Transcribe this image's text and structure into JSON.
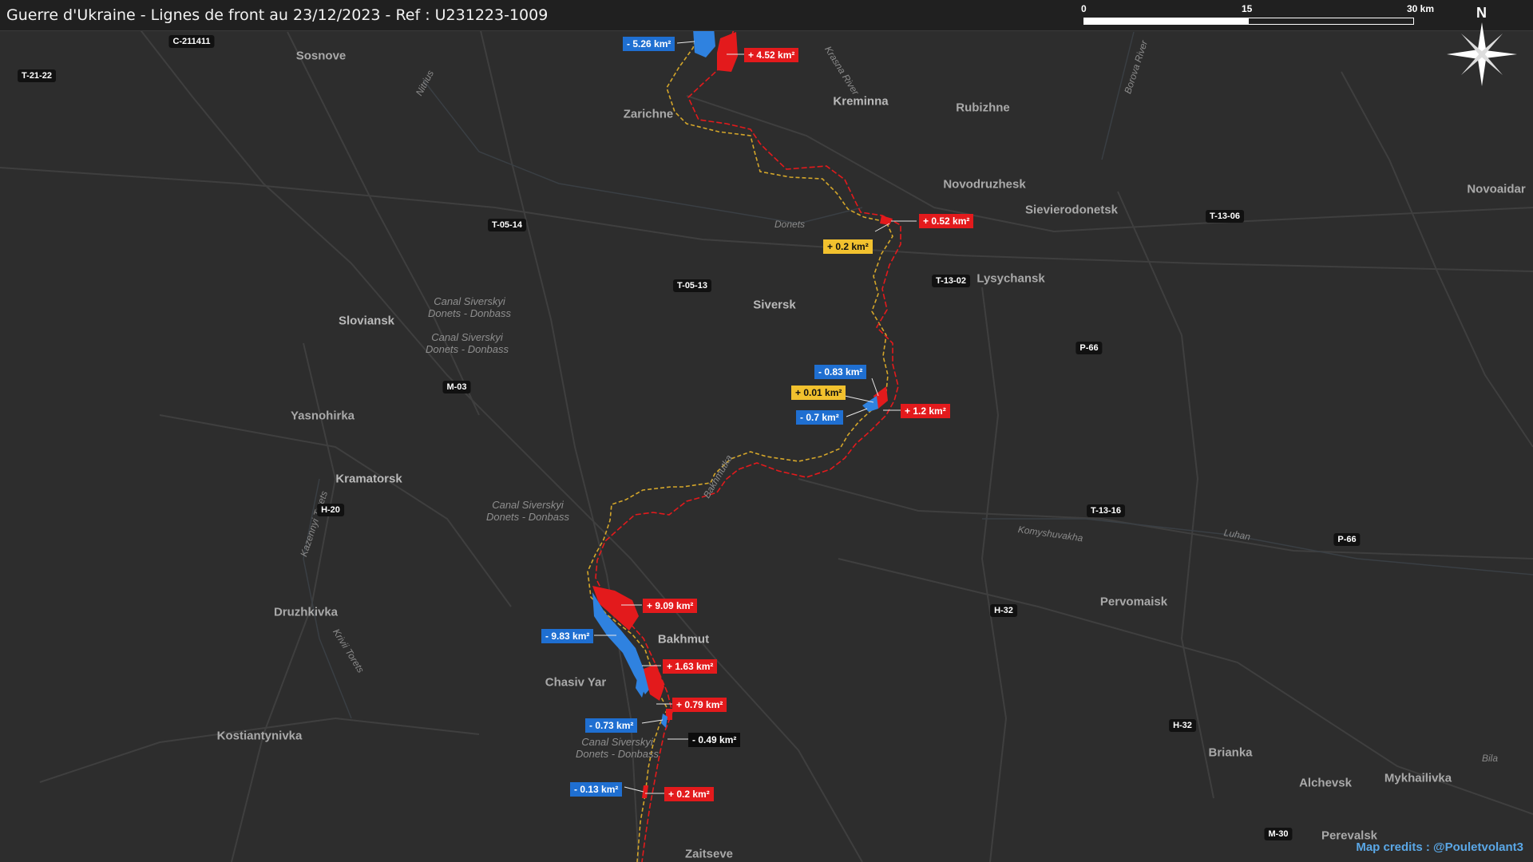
{
  "header": {
    "title": "Guerre d'Ukraine - Lignes de front au 23/12/2023 - Ref : U231223-1009",
    "scale_labels": [
      "0",
      "15",
      "30 km"
    ],
    "north_label": "N"
  },
  "colors": {
    "gain": "#e31a1c",
    "loss": "#1f6fd1",
    "contested": "#f2c12e",
    "other": "#0c0c0c",
    "front_line_red": "#e31a1c",
    "front_line_yellow": "#d4a62a",
    "map_background": "#2d2d2d"
  },
  "towns": [
    {
      "name": "Sosnove"
    },
    {
      "name": "Zarichne"
    },
    {
      "name": "Kreminna"
    },
    {
      "name": "Rubizhne"
    },
    {
      "name": "Novodruzhesk"
    },
    {
      "name": "Sievierodonetsk"
    },
    {
      "name": "Novoaidar"
    },
    {
      "name": "Lysychansk"
    },
    {
      "name": "Siversk"
    },
    {
      "name": "Sloviansk"
    },
    {
      "name": "Yasnohirka"
    },
    {
      "name": "Kramatorsk"
    },
    {
      "name": "Druzhkivka"
    },
    {
      "name": "Bakhmut"
    },
    {
      "name": "Chasiv Yar"
    },
    {
      "name": "Kostiantynivka"
    },
    {
      "name": "Pervomaisk"
    },
    {
      "name": "Brianka"
    },
    {
      "name": "Alchevsk"
    },
    {
      "name": "Mykhailivka"
    },
    {
      "name": "Perevalsk"
    },
    {
      "name": "Zaitseve"
    }
  ],
  "canals": [
    {
      "text": "Canal Siverskyi Donets - Donbass"
    },
    {
      "text": "Canal Siverskyi Donets - Donbass"
    },
    {
      "text": "Canal Siverskyi Donets - Donbass"
    },
    {
      "text": "Canal Siverskyi Donets - Donbass"
    }
  ],
  "rivers": [
    {
      "name": "Krasna River"
    },
    {
      "name": "Borova River"
    },
    {
      "name": "Nitrius"
    },
    {
      "name": "Donets"
    },
    {
      "name": "Bakhmutka"
    },
    {
      "name": "Kazennyi Torets"
    },
    {
      "name": "Krivii Torets"
    },
    {
      "name": "Komyshuvakha"
    },
    {
      "name": "Luhan"
    },
    {
      "name": "Bila"
    }
  ],
  "roads": [
    {
      "label": "C-211411"
    },
    {
      "label": "T-21-22"
    },
    {
      "label": "T-05-14"
    },
    {
      "label": "T-05-13"
    },
    {
      "label": "T-13-02"
    },
    {
      "label": "T-13-06"
    },
    {
      "label": "P-66"
    },
    {
      "label": "M-03"
    },
    {
      "label": "H-20"
    },
    {
      "label": "T-13-16"
    },
    {
      "label": "P-66"
    },
    {
      "label": "H-32"
    },
    {
      "label": "H-32"
    },
    {
      "label": "M-30"
    }
  ],
  "changes": [
    {
      "label": "- 5.26 km²",
      "kind": "loss"
    },
    {
      "label": "+ 4.52 km²",
      "kind": "gain"
    },
    {
      "label": "+ 0.52 km²",
      "kind": "gain"
    },
    {
      "label": "+ 0.2 km²",
      "kind": "contested"
    },
    {
      "label": "- 0.83 km²",
      "kind": "loss"
    },
    {
      "label": "+ 0.01 km²",
      "kind": "contested"
    },
    {
      "label": "- 0.7 km²",
      "kind": "loss"
    },
    {
      "label": "+ 1.2 km²",
      "kind": "gain"
    },
    {
      "label": "+ 9.09 km²",
      "kind": "gain"
    },
    {
      "label": "- 9.83 km²",
      "kind": "loss"
    },
    {
      "label": "+ 1.63 km²",
      "kind": "gain"
    },
    {
      "label": "+ 0.79 km²",
      "kind": "gain"
    },
    {
      "label": "- 0.73 km²",
      "kind": "loss"
    },
    {
      "label": "- 0.49 km²",
      "kind": "other"
    },
    {
      "label": "- 0.13 km²",
      "kind": "loss"
    },
    {
      "label": "+ 0.2 km²",
      "kind": "gain"
    }
  ],
  "footer": {
    "credits": "Map credits : @Pouletvolant3"
  }
}
